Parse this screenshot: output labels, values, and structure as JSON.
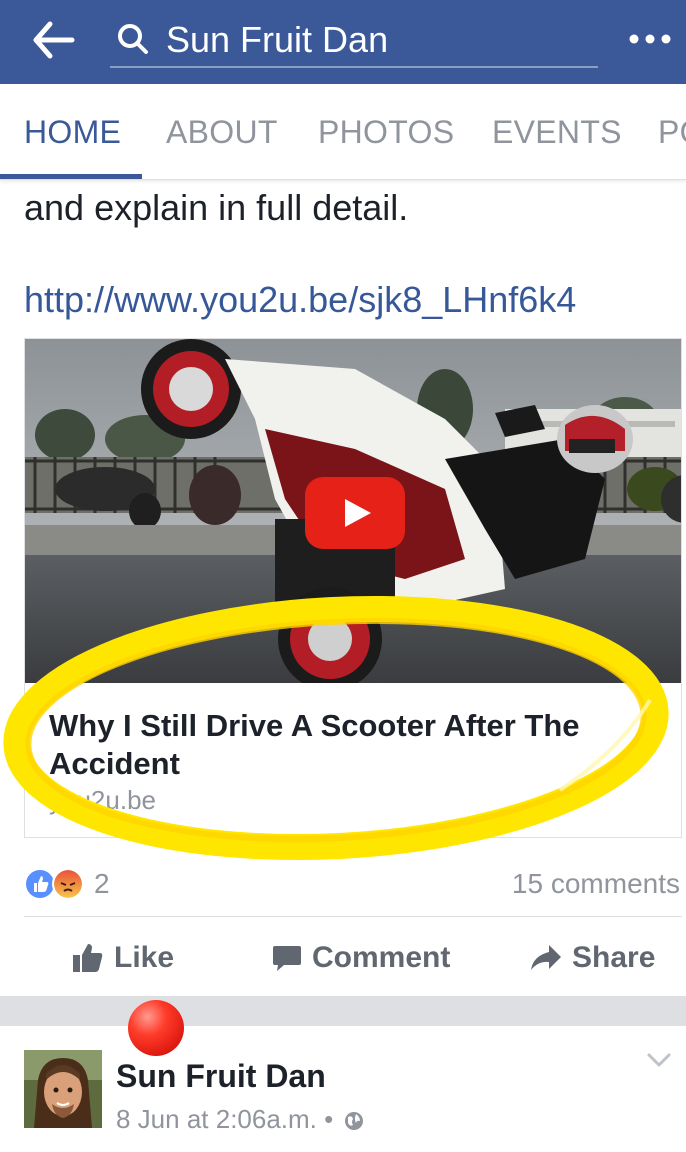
{
  "topbar": {
    "search_query": "Sun Fruit Dan",
    "bg_color": "#3b5998"
  },
  "tabs": [
    {
      "label": "HOME",
      "active": true
    },
    {
      "label": "ABOUT",
      "active": false
    },
    {
      "label": "PHOTOS",
      "active": false
    },
    {
      "label": "EVENTS",
      "active": false
    },
    {
      "label": "PO",
      "active": false
    }
  ],
  "post": {
    "text_tail": "and explain in full detail.",
    "link_url": "http://www.you2u.be/sjk8_LHnf6k4",
    "card": {
      "title": "Why I Still Drive A Scooter After The Accident",
      "domain": "you2u.be",
      "play_icon": "play-icon"
    },
    "reactions": {
      "types": [
        "like",
        "angry"
      ],
      "count": "2"
    },
    "comments_label": "15 comments",
    "actions": {
      "like": "Like",
      "comment": "Comment",
      "share": "Share"
    }
  },
  "next_post": {
    "author": "Sun Fruit Dan",
    "date": "8 Jun at 2:06a.m.",
    "separator": "•",
    "privacy_icon": "globe-icon"
  },
  "colors": {
    "link": "#365899",
    "muted": "#90949c",
    "highlight": "#ffe600"
  }
}
